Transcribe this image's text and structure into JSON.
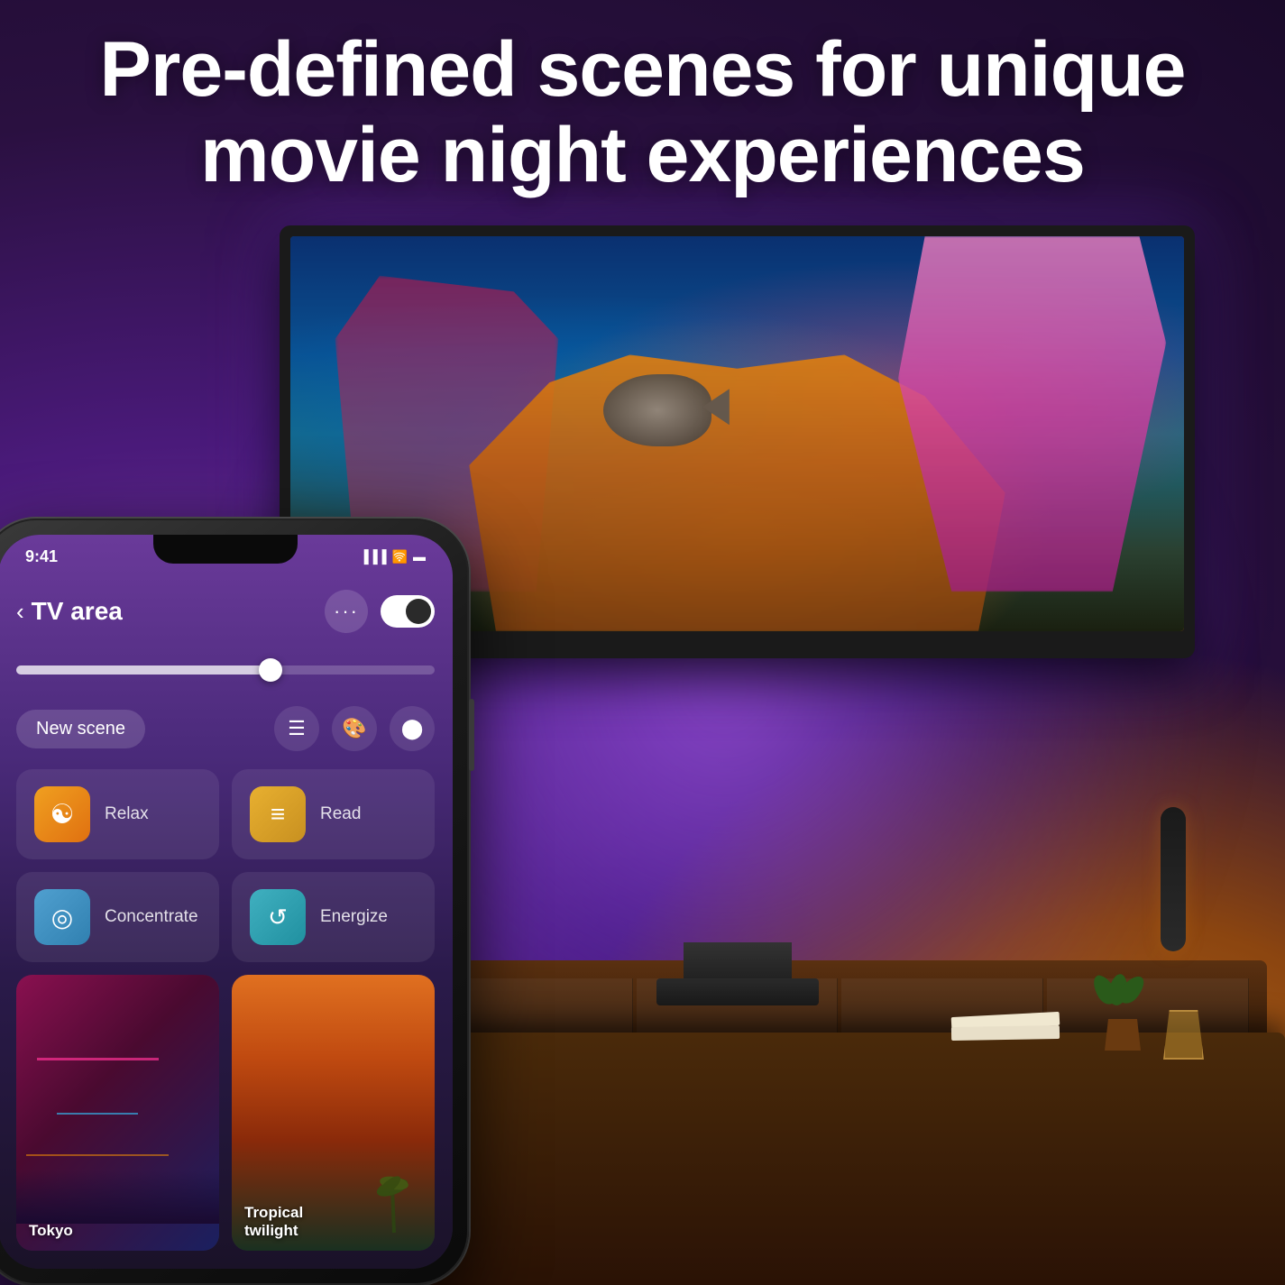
{
  "heading": {
    "line1": "Pre-defined scenes for unique",
    "line2": "movie night experiences"
  },
  "phone": {
    "status_bar": {
      "time": "9:41",
      "signal_icon": "signal-icon",
      "wifi_icon": "wifi-icon",
      "battery_icon": "battery-icon"
    },
    "header": {
      "back_label": "‹",
      "title": "TV area",
      "more_label": "···",
      "toggle_on": true
    },
    "toolbar": {
      "new_scene_label": "New scene",
      "list_icon": "list-icon",
      "palette_icon": "palette-icon",
      "color_wheel_icon": "color-wheel-icon"
    },
    "scenes": [
      {
        "id": "relax",
        "label": "Relax",
        "icon_type": "relax",
        "icon_emoji": "☯"
      },
      {
        "id": "read",
        "label": "Read",
        "icon_type": "read",
        "icon_emoji": "≡"
      },
      {
        "id": "concentrate",
        "label": "Concentrate",
        "icon_type": "concentrate",
        "icon_emoji": "◎"
      },
      {
        "id": "energize",
        "label": "Energize",
        "icon_type": "energize",
        "icon_emoji": "↺"
      },
      {
        "id": "tokyo",
        "label": "Tokyo",
        "icon_type": "image-tokyo"
      },
      {
        "id": "tropical-twilight",
        "label": "Tropical twilight",
        "icon_type": "image-tropical"
      }
    ]
  },
  "colors": {
    "bg_purple": "#2a1a4a",
    "accent_orange": "#c87820",
    "phone_dark": "#1a1a1a"
  }
}
